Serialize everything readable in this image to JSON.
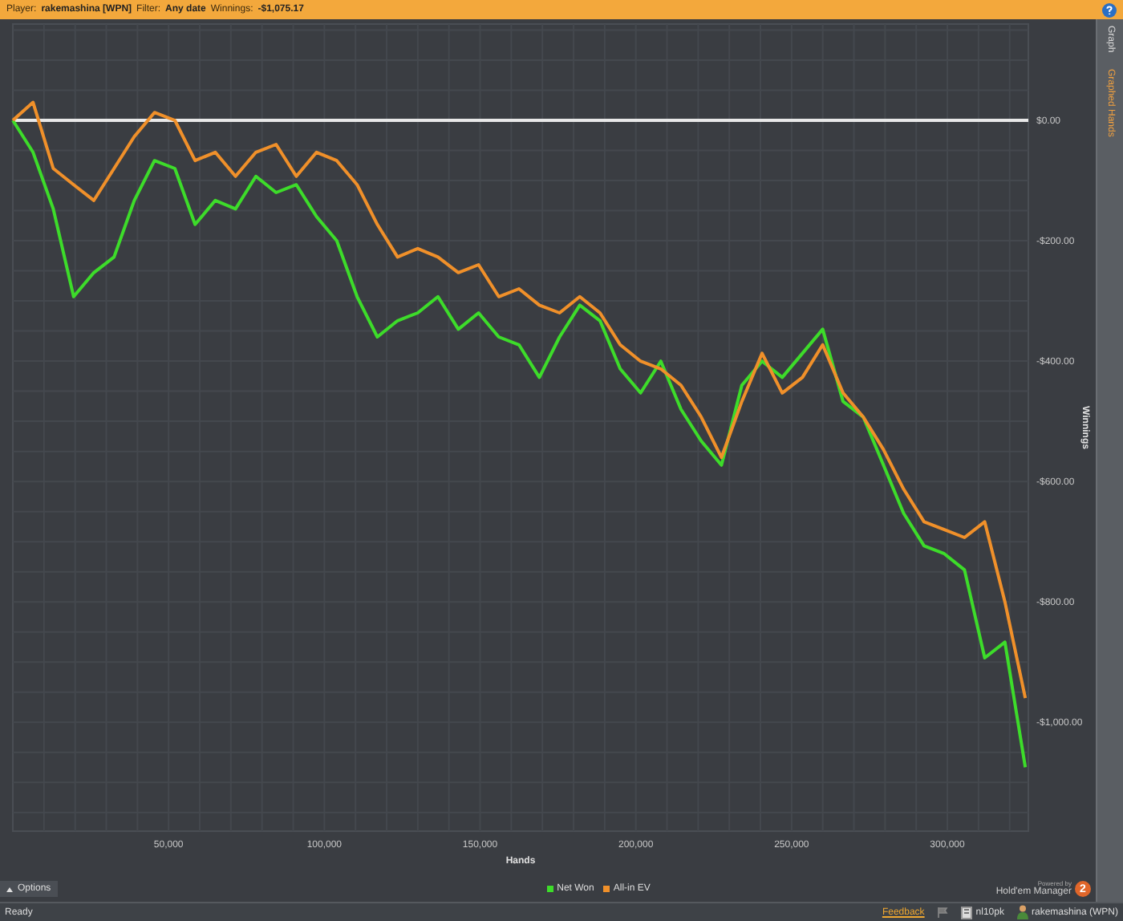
{
  "header": {
    "player_label": "Player:",
    "player": "rakemashina [WPN]",
    "filter_label": "Filter:",
    "filter": "Any date",
    "winnings_label": "Winnings:",
    "winnings": "-$1,075.17"
  },
  "side_tabs": [
    {
      "label": "Graph",
      "selected": false
    },
    {
      "label": "Graphed Hands",
      "selected": true
    }
  ],
  "chart": {
    "chart_data": {
      "type": "line",
      "grid": true,
      "xlabel": "Hands",
      "ylabel": "Winnings",
      "xlim": [
        0,
        326000
      ],
      "ylim": [
        -1181,
        160
      ],
      "xticks": [
        {
          "value": 50000,
          "label": "50,000"
        },
        {
          "value": 100000,
          "label": "100,000"
        },
        {
          "value": 150000,
          "label": "150,000"
        },
        {
          "value": 200000,
          "label": "200,000"
        },
        {
          "value": 250000,
          "label": "250,000"
        },
        {
          "value": 300000,
          "label": "300,000"
        }
      ],
      "yticks": [
        {
          "value": 0,
          "label": "$0.00"
        },
        {
          "value": -200,
          "label": "-$200.00"
        },
        {
          "value": -400,
          "label": "-$400.00"
        },
        {
          "value": -600,
          "label": "-$600.00"
        },
        {
          "value": -800,
          "label": "-$800.00"
        },
        {
          "value": -1000,
          "label": "-$1,000.00"
        }
      ],
      "x": [
        0,
        6500,
        13000,
        19500,
        26000,
        32500,
        39000,
        45500,
        52000,
        58500,
        65000,
        71500,
        78000,
        84500,
        91000,
        97500,
        104000,
        110500,
        117000,
        123500,
        130000,
        136500,
        143000,
        149500,
        156000,
        162500,
        169000,
        175500,
        182000,
        188500,
        195000,
        201500,
        208000,
        214500,
        221000,
        227500,
        234000,
        240500,
        247000,
        253500,
        260000,
        266500,
        273000,
        279500,
        286000,
        292500,
        299000,
        305500,
        312000,
        318500,
        325000
      ],
      "series": [
        {
          "name": "Net Won",
          "color": "#3ddc2a",
          "values": [
            0,
            -53,
            -147,
            -293,
            -253,
            -227,
            -133,
            -67,
            -80,
            -173,
            -133,
            -147,
            -93,
            -120,
            -107,
            -160,
            -200,
            -293,
            -360,
            -333,
            -320,
            -293,
            -347,
            -320,
            -360,
            -373,
            -427,
            -360,
            -307,
            -333,
            -413,
            -453,
            -400,
            -480,
            -533,
            -573,
            -440,
            -400,
            -427,
            -387,
            -347,
            -467,
            -493,
            -573,
            -653,
            -707,
            -720,
            -747,
            -893,
            -867,
            -1075
          ]
        },
        {
          "name": "All-in EV",
          "color": "#f0902a",
          "values": [
            0,
            30,
            -80,
            -107,
            -133,
            -80,
            -27,
            13,
            0,
            -67,
            -53,
            -93,
            -53,
            -40,
            -93,
            -53,
            -67,
            -107,
            -173,
            -227,
            -213,
            -227,
            -253,
            -240,
            -293,
            -280,
            -307,
            -320,
            -293,
            -320,
            -373,
            -400,
            -413,
            -440,
            -493,
            -560,
            -467,
            -387,
            -453,
            -427,
            -373,
            -453,
            -493,
            -547,
            -613,
            -667,
            -680,
            -693,
            -667,
            -800,
            -960
          ]
        }
      ]
    }
  },
  "options_button": "Options",
  "branding": {
    "powered_by": "Powered by",
    "product": "Hold'em Manager",
    "badge": "2"
  },
  "status_bar": {
    "status": "Ready",
    "feedback": "Feedback",
    "database": "nl10pk",
    "player": "rakemashina (WPN)"
  }
}
